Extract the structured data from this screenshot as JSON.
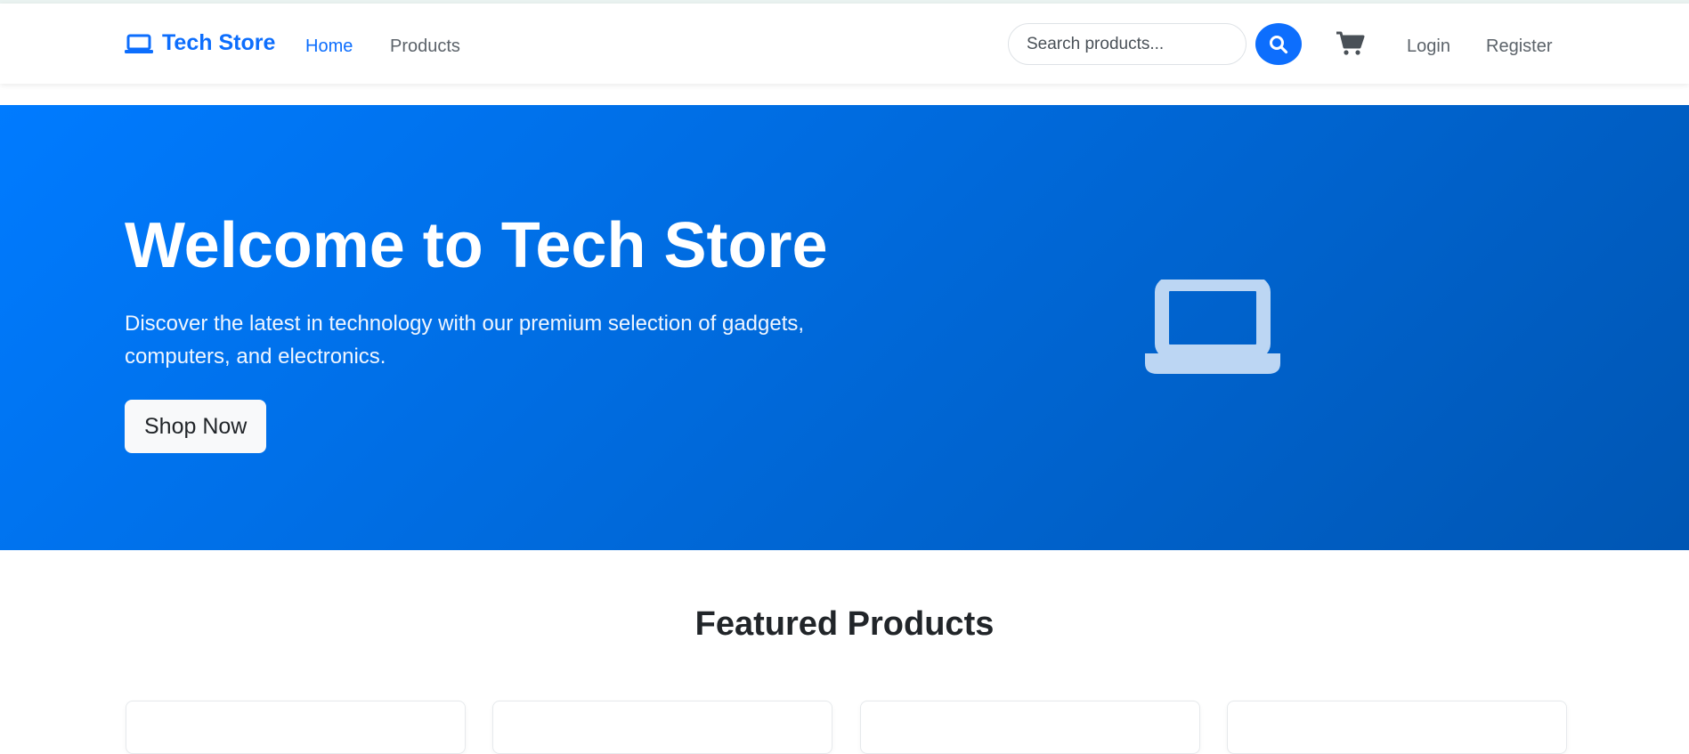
{
  "colors": {
    "primary": "#0d6efd",
    "hero_gradient_start": "#007bff",
    "hero_gradient_end": "#0056b3",
    "nav_text": "#5c636a"
  },
  "navbar": {
    "brand": {
      "icon": "laptop-icon",
      "label": "Tech Store"
    },
    "links": [
      {
        "label": "Home",
        "active": true
      },
      {
        "label": "Products",
        "active": false
      }
    ],
    "search": {
      "placeholder": "Search products...",
      "value": "",
      "button_icon": "search-icon"
    },
    "cart_icon": "cart-icon",
    "login_label": "Login",
    "register_label": "Register"
  },
  "hero": {
    "title": "Welcome to Tech Store",
    "subtitle": "Discover the latest in technology with our premium selection of gadgets, computers, and electronics.",
    "cta_label": "Shop Now",
    "illustration_icon": "laptop-icon"
  },
  "featured": {
    "title": "Featured Products"
  }
}
